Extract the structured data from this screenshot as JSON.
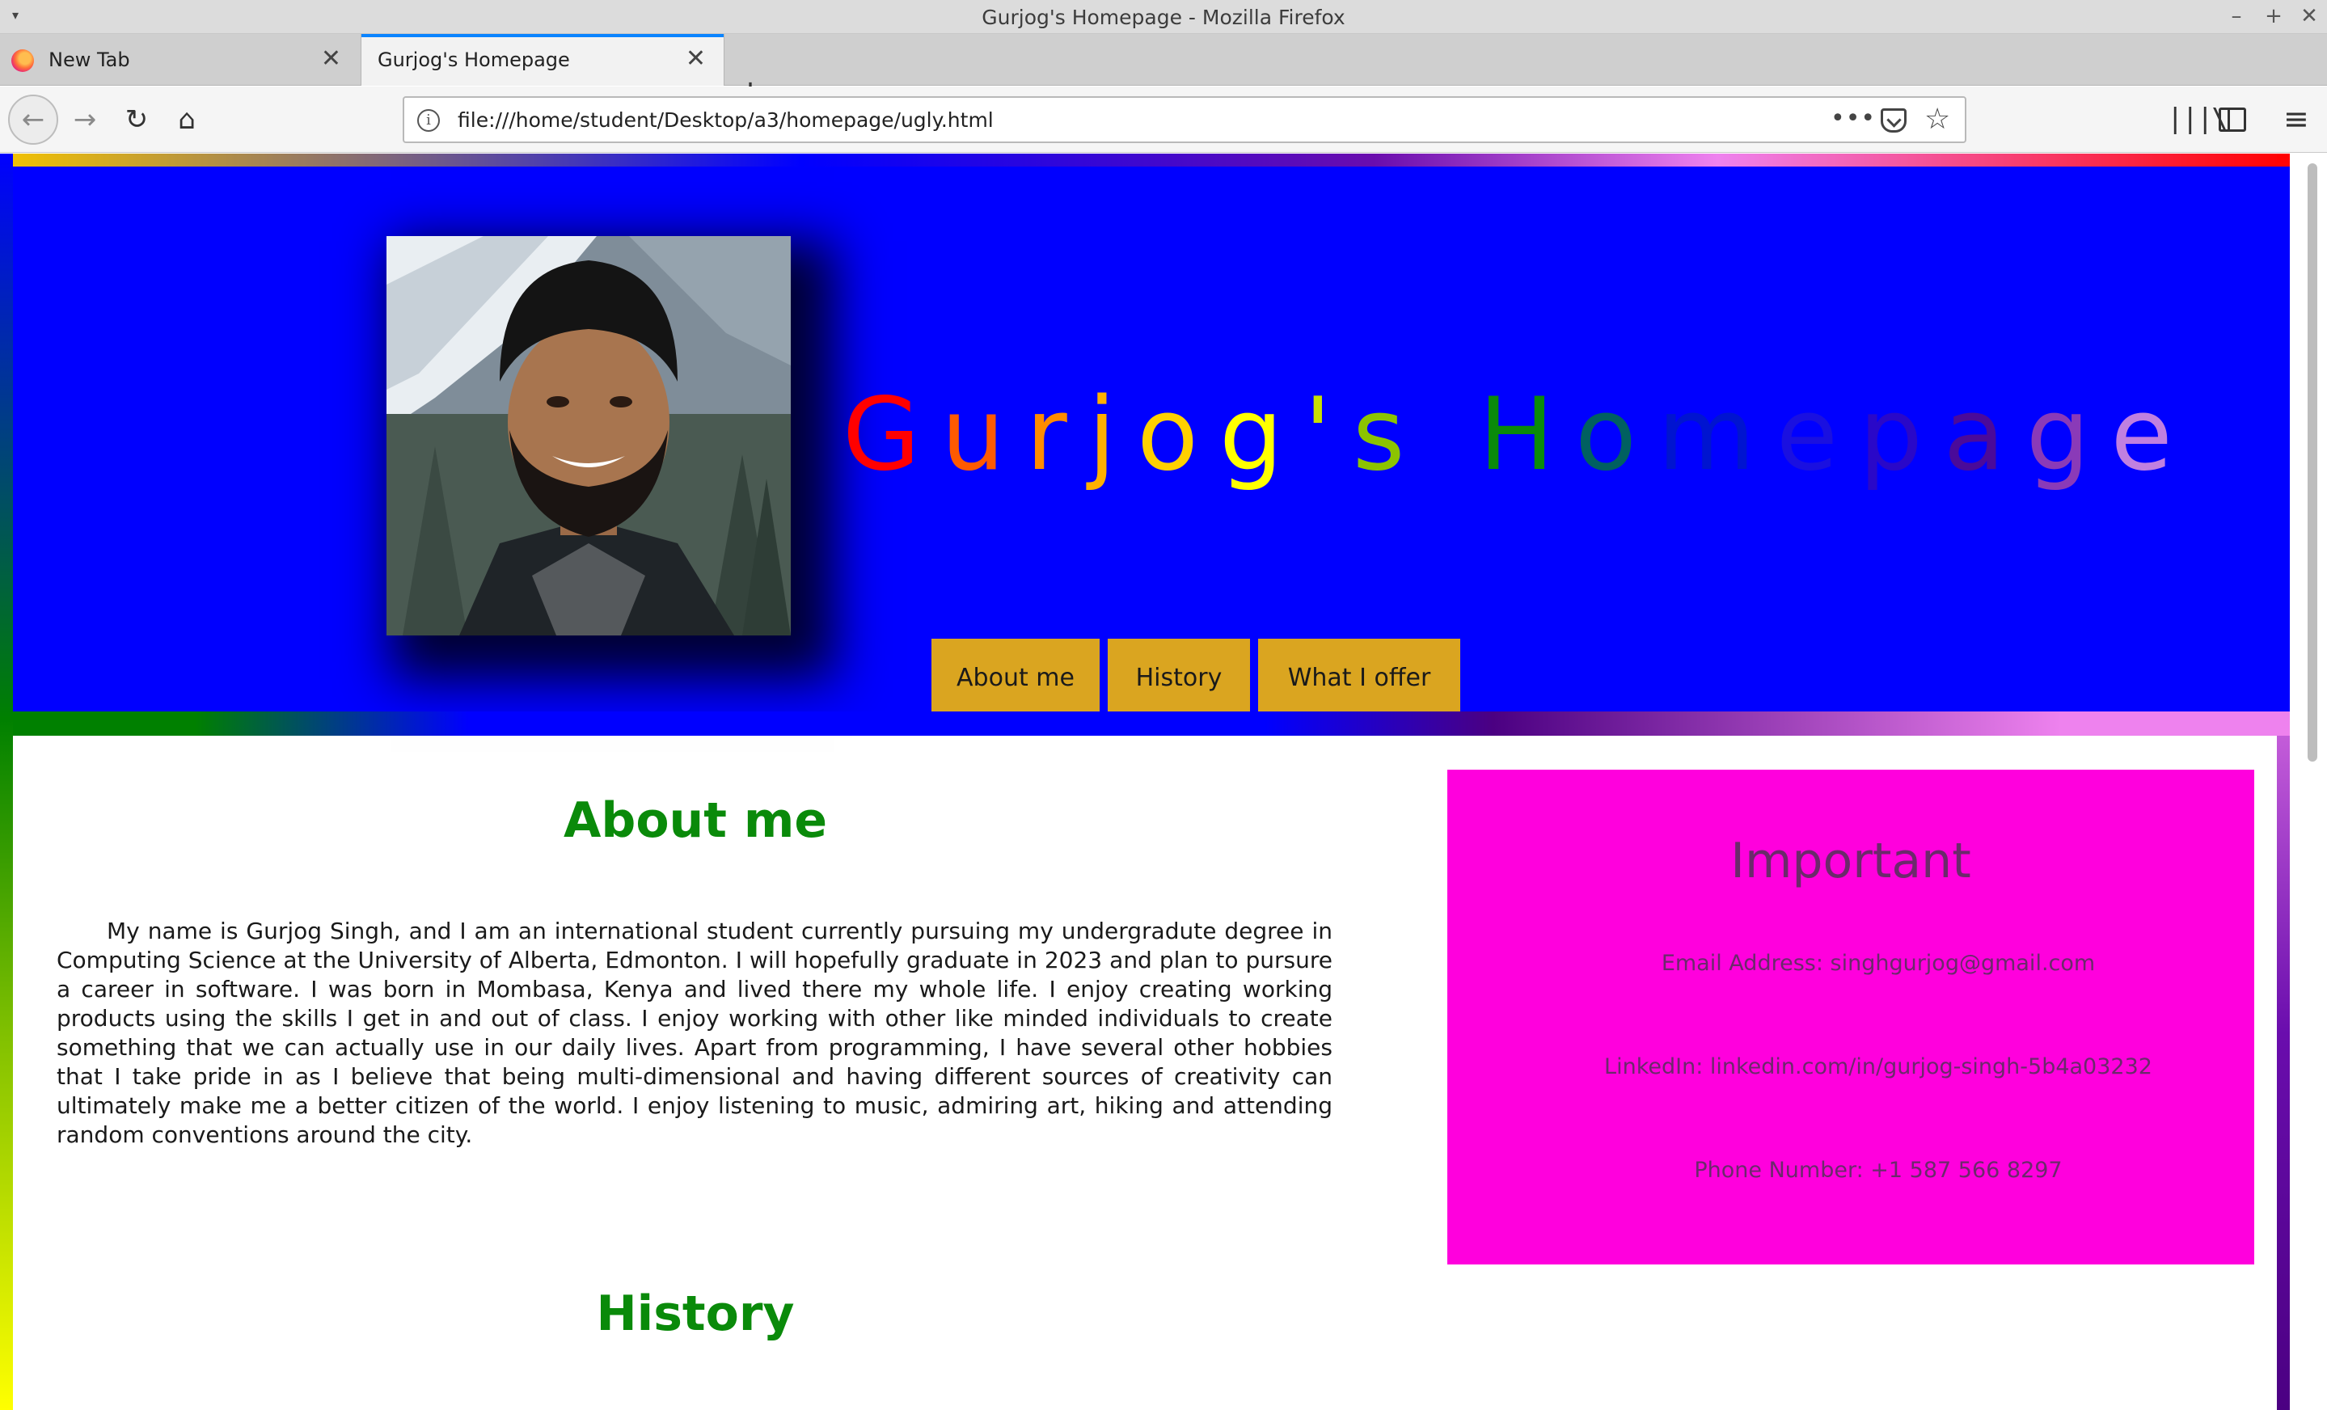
{
  "window": {
    "title": "Gurjog's Homepage - Mozilla Firefox",
    "minimize_glyph": "–",
    "maximize_glyph": "+",
    "close_glyph": "✕",
    "menu_glyph": "▾"
  },
  "tabs": [
    {
      "label": "New Tab",
      "active": false
    },
    {
      "label": "Gurjog's Homepage",
      "active": true
    }
  ],
  "tab_close_glyph": "✕",
  "new_tab_glyph": "+",
  "toolbar": {
    "back_glyph": "←",
    "forward_glyph": "→",
    "reload_glyph": "↻",
    "home_glyph": "⌂",
    "url": "file:///home/student/Desktop/a3/homepage/ugly.html",
    "info_glyph": "i",
    "more_glyph": "•••",
    "star_glyph": "☆",
    "library_glyph": "|||\\",
    "menu_glyph": "≡"
  },
  "header": {
    "title_letters": [
      {
        "ch": "G",
        "color": "#ff0000"
      },
      {
        "ch": "u",
        "color": "#ff5a00"
      },
      {
        "ch": "r",
        "color": "#ff8c00"
      },
      {
        "ch": "j",
        "color": "#ffb000"
      },
      {
        "ch": "o",
        "color": "#ffd000"
      },
      {
        "ch": "g",
        "color": "#ffff00"
      },
      {
        "ch": "'",
        "color": "#c8e000"
      },
      {
        "ch": "s",
        "color": "#8cc400"
      },
      {
        "ch": " ",
        "color": "#0000ff"
      },
      {
        "ch": "H",
        "color": "#0a8a0a"
      },
      {
        "ch": "o",
        "color": "#006060"
      },
      {
        "ch": "m",
        "color": "#0014d0"
      },
      {
        "ch": "e",
        "color": "#1a10e0"
      },
      {
        "ch": "p",
        "color": "#2a08c8"
      },
      {
        "ch": "a",
        "color": "#4a0a9a"
      },
      {
        "ch": "g",
        "color": "#8a3ab8"
      },
      {
        "ch": "e",
        "color": "#c080e0"
      }
    ],
    "nav": [
      "About me",
      "History",
      "What I offer"
    ]
  },
  "about": {
    "heading": "About me",
    "body": "My name is Gurjog Singh, and I am an international student currently pursuing my undergradute degree in Computing Science at the University of Alberta, Edmonton. I will hopefully graduate in 2023 and plan to pursure a career in software. I was born in Mombasa, Kenya and lived there my whole life. I enjoy creating working products using the skills I get in and out of class. I enjoy working with other like minded individuals to create something that we can actually use in our daily lives. Apart from programming, I have several other hobbies that I take pride in as I believe that being multi-dimensional and having different sources of creativity can ultimately make me a better citizen of the world. I enjoy listening to music, admiring art, hiking and attending random conventions around the city."
  },
  "important": {
    "heading": "Important",
    "email": "Email Address: singhgurjog@gmail.com",
    "linkedin": "LinkedIn: linkedin.com/in/gurjog-singh-5b4a03232",
    "phone": "Phone Number: +1 587 566 8297"
  },
  "history": {
    "heading": "History"
  }
}
